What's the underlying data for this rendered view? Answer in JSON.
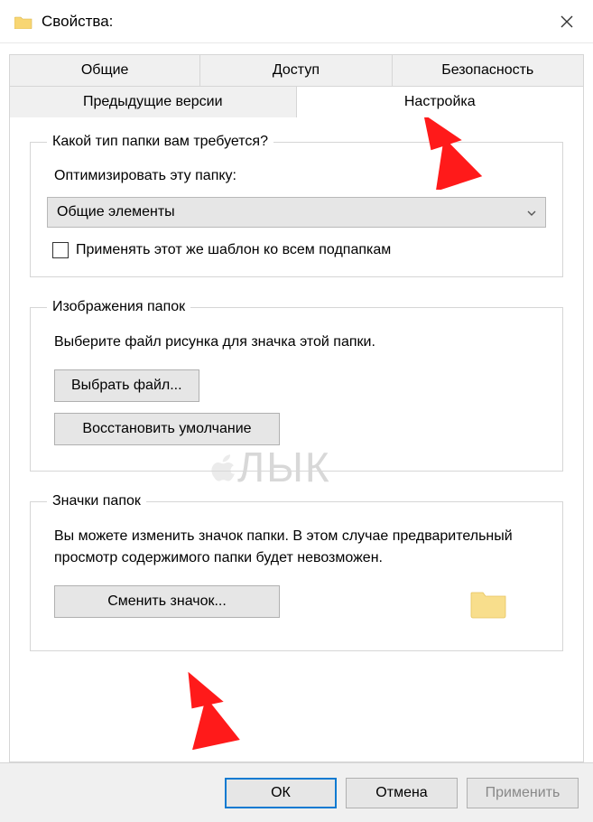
{
  "titlebar": {
    "title": "Свойства:"
  },
  "tabs": {
    "general": "Общие",
    "sharing": "Доступ",
    "security": "Безопасность",
    "previous": "Предыдущие версии",
    "customize": "Настройка"
  },
  "group1": {
    "legend": "Какой тип папки вам требуется?",
    "optimize_label": "Оптимизировать эту папку:",
    "dropdown_value": "Общие элементы",
    "apply_subfolders": "Применять этот же шаблон ко всем подпапкам"
  },
  "group2": {
    "legend": "Изображения папок",
    "desc": "Выберите файл рисунка для значка этой папки.",
    "choose_file": "Выбрать файл...",
    "restore_default": "Восстановить умолчание"
  },
  "group3": {
    "legend": "Значки папок",
    "desc": "Вы можете изменить значок папки. В этом случае предварительный просмотр содержимого папки будет невозможен.",
    "change_icon": "Сменить значок..."
  },
  "footer": {
    "ok": "ОК",
    "cancel": "Отмена",
    "apply": "Применить"
  },
  "watermark": "ЛЫК"
}
